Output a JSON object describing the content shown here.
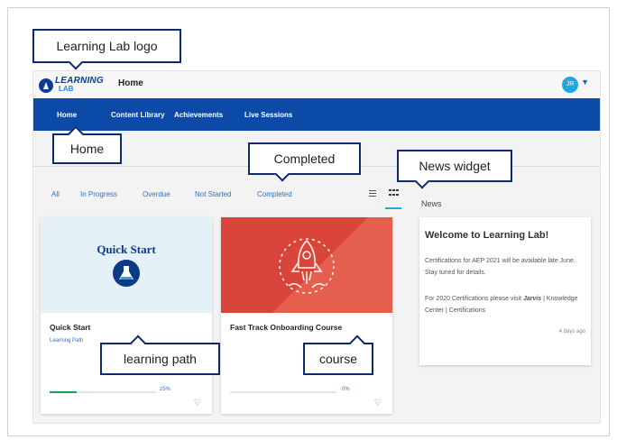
{
  "app": {
    "logo_top": "LEARNING",
    "logo_bottom": "LAB",
    "title": "Home",
    "user_initials": "JR"
  },
  "nav": {
    "items": [
      "Home",
      "Content Library",
      "Achievements",
      "Live Sessions"
    ]
  },
  "filters": {
    "items": [
      "All",
      "In Progress",
      "Overdue",
      "Not Started",
      "Completed"
    ]
  },
  "news": {
    "label": "News",
    "title": "Welcome to Learning Lab!",
    "paragraph1": "Certifications for AEP 2021 will be available late June. Stay tuned for details.",
    "paragraph2_prefix": "For 2020 Certifications please visit ",
    "paragraph2_link": "Jarvis",
    "paragraph2_suffix": " | Knowledge Center | Certifications",
    "timestamp": "4 days ago"
  },
  "cards": [
    {
      "image_text": "Quick Start",
      "title": "Quick Start",
      "subtitle": "Learning Path",
      "progress_percent": 25,
      "progress_label": "25%"
    },
    {
      "image_text": "",
      "title": "Fast Track Onboarding Course",
      "subtitle": "",
      "progress_percent": 0,
      "progress_label": "0%"
    }
  ],
  "callouts": {
    "logo": "Learning Lab logo",
    "home": "Home",
    "completed": "Completed",
    "news_widget": "News widget",
    "learning_path": "learning path",
    "course": "course"
  },
  "colors": {
    "nav_bg": "#0b4aa6",
    "accent": "#1ea7e0",
    "progress": "#1b9e52",
    "course_red": "#d9453a",
    "callout_border": "#0d2a6e"
  },
  "icons": [
    "logo-icon",
    "user-avatar",
    "chevron-down-icon",
    "list-view-icon",
    "grid-view-icon",
    "flask-icon",
    "rocket-icon",
    "heart-icon"
  ]
}
